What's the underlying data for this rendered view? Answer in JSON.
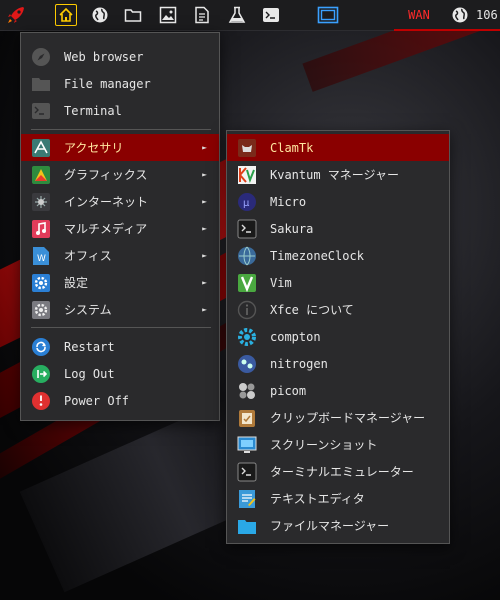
{
  "panel": {
    "wan_label": "WAN",
    "volume_value": "106",
    "colors": {
      "accent": "#c00000",
      "home": "#ffcc00",
      "window_button": "#3aa0ff"
    }
  },
  "main_menu": {
    "items": [
      {
        "label": "Web browser",
        "icon": "compass-icon"
      },
      {
        "label": "File manager",
        "icon": "folder-icon"
      },
      {
        "label": "Terminal",
        "icon": "terminal-icon"
      }
    ],
    "categories": [
      {
        "label": "アクセサリ",
        "icon": "accessories-icon",
        "active": true
      },
      {
        "label": "グラフィックス",
        "icon": "graphics-icon"
      },
      {
        "label": "インターネット",
        "icon": "internet-icon"
      },
      {
        "label": "マルチメディア",
        "icon": "multimedia-icon"
      },
      {
        "label": "オフィス",
        "icon": "office-icon"
      },
      {
        "label": "設定",
        "icon": "settings-icon"
      },
      {
        "label": "システム",
        "icon": "system-icon"
      }
    ],
    "actions": [
      {
        "label": "Restart",
        "icon": "restart-icon"
      },
      {
        "label": "Log Out",
        "icon": "logout-icon"
      },
      {
        "label": "Power Off",
        "icon": "power-icon"
      }
    ],
    "arrow": "►"
  },
  "sub_menu": {
    "items": [
      {
        "label": "ClamTk",
        "icon": "clamtk-icon",
        "active": true
      },
      {
        "label": "Kvantum マネージャー",
        "icon": "kvantum-icon"
      },
      {
        "label": "Micro",
        "icon": "micro-icon"
      },
      {
        "label": "Sakura",
        "icon": "sakura-terminal-icon"
      },
      {
        "label": "TimezoneClock",
        "icon": "globe-clock-icon"
      },
      {
        "label": "Vim",
        "icon": "vim-icon"
      },
      {
        "label": "Xfce について",
        "icon": "info-icon"
      },
      {
        "label": "compton",
        "icon": "compton-icon"
      },
      {
        "label": "nitrogen",
        "icon": "nitrogen-icon"
      },
      {
        "label": "picom",
        "icon": "picom-icon"
      },
      {
        "label": "クリップボードマネージャー",
        "icon": "clipboard-icon"
      },
      {
        "label": "スクリーンショット",
        "icon": "screenshot-icon"
      },
      {
        "label": "ターミナルエミュレーター",
        "icon": "terminal-emulator-icon"
      },
      {
        "label": "テキストエディタ",
        "icon": "text-editor-icon"
      },
      {
        "label": "ファイルマネージャー",
        "icon": "file-manager-icon"
      }
    ]
  }
}
